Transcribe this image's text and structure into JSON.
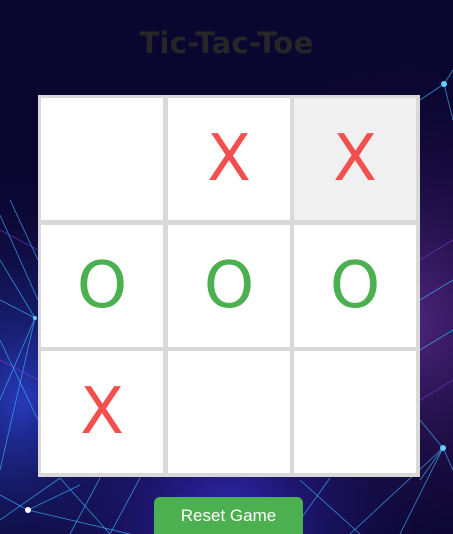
{
  "title": "Tic-Tac-Toe",
  "board": [
    "",
    "X",
    "X",
    "O",
    "O",
    "O",
    "X",
    "",
    ""
  ],
  "highlighted_cell": 2,
  "reset_label": "Reset Game",
  "colors": {
    "x": "#f44f4f",
    "o": "#4caf50",
    "button": "#4caf50",
    "title": "#262626",
    "background": "#0b0630"
  }
}
